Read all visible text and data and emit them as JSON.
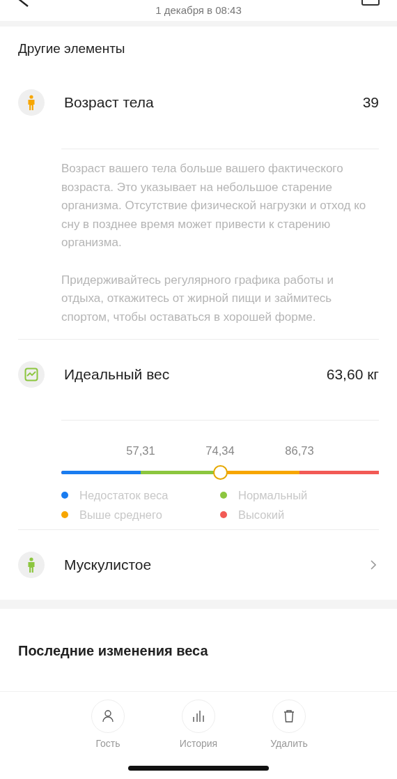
{
  "header": {
    "date": "1 декабря в 08:43"
  },
  "section_title": "Другие элементы",
  "body_age": {
    "title": "Возраст тела",
    "value": "39",
    "description": [
      "Возраст вашего тела больше вашего фактического возраста. Это указывает на небольшое старение организма. Отсутствие физической нагрузки и отход ко сну в позднее время может привести к старению организма.",
      "Придерживайтесь регулярного графика работы и отдыха, откажитесь от жирной пищи и займитесь спортом, чтобы оставаться в хорошей форме."
    ]
  },
  "ideal_weight": {
    "title": "Идеальный вес",
    "value": "63,60 кг",
    "scale": {
      "thresholds": [
        "57,31",
        "74,34",
        "86,73"
      ],
      "level": 0.5,
      "segments": [
        {
          "label": "Недостаток веса",
          "color": "#1a7cf0"
        },
        {
          "label": "Нормальный",
          "color": "#8cc63f"
        },
        {
          "label": "Выше среднего",
          "color": "#f7a600"
        },
        {
          "label": "Высокий",
          "color": "#f25a55"
        }
      ]
    }
  },
  "body_type": {
    "title": "Мускулистое"
  },
  "recent_title": "Последние изменения веса",
  "actions": [
    {
      "label": "Гость"
    },
    {
      "label": "История"
    },
    {
      "label": "Удалить"
    }
  ]
}
